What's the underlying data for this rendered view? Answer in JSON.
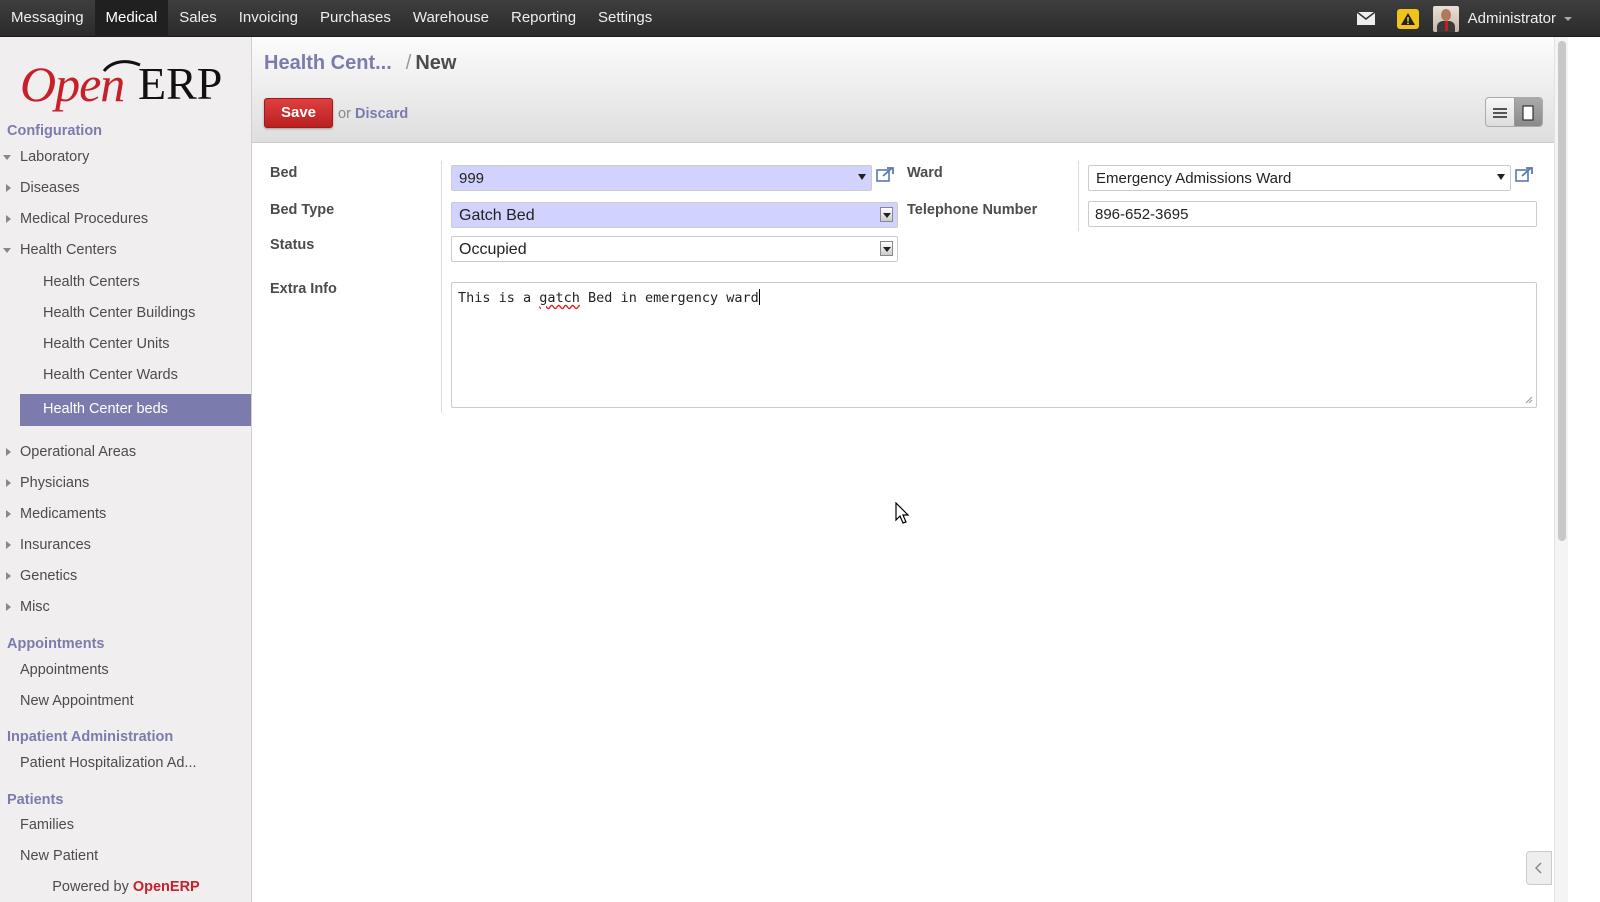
{
  "topbar": {
    "menu": [
      "Messaging",
      "Medical",
      "Sales",
      "Invoicing",
      "Purchases",
      "Warehouse",
      "Reporting",
      "Settings"
    ],
    "active_menu": "Medical",
    "user": "Administrator"
  },
  "sidebar": {
    "logo": {
      "open": "Open",
      "erp": "ERP"
    },
    "configuration": {
      "title": "Configuration",
      "items": [
        "Laboratory",
        "Diseases",
        "Medical Procedures",
        "Health Centers"
      ],
      "health_center_sub": [
        "Health Centers",
        "Health Center Buildings",
        "Health Center Units",
        "Health Center Wards",
        "Health Center beds"
      ],
      "more_items": [
        "Operational Areas",
        "Physicians",
        "Medicaments",
        "Insurances",
        "Genetics",
        "Misc"
      ]
    },
    "appointments": {
      "title": "Appointments",
      "items": [
        "Appointments",
        "New Appointment"
      ]
    },
    "inpatient": {
      "title": "Inpatient Administration",
      "items": [
        "Patient Hospitalization Ad..."
      ]
    },
    "patients": {
      "title": "Patients",
      "items": [
        "Families",
        "New Patient"
      ]
    },
    "powered_by": "Powered by",
    "powered_brand": "OpenERP"
  },
  "header": {
    "breadcrumb_parent": "Health Cent...",
    "breadcrumb_sep": "/",
    "breadcrumb_current": "New",
    "save_label": "Save",
    "or_label": "or",
    "discard_label": "Discard"
  },
  "form": {
    "bed": {
      "label": "Bed",
      "value": "999"
    },
    "bed_type": {
      "label": "Bed Type",
      "value": "Gatch Bed"
    },
    "status": {
      "label": "Status",
      "value": "Occupied"
    },
    "ward": {
      "label": "Ward",
      "value": "Emergency Admissions Ward"
    },
    "telephone": {
      "label": "Telephone Number",
      "value": "896-652-3695"
    },
    "extra_info": {
      "label": "Extra Info",
      "value_before": "This is a ",
      "value_misspelled": "gatch",
      "value_after": " Bed in emergency ward"
    }
  },
  "colors": {
    "accent": "#7c7bad",
    "brand_red": "#c8202a",
    "required_bg": "#d2d2ff"
  }
}
